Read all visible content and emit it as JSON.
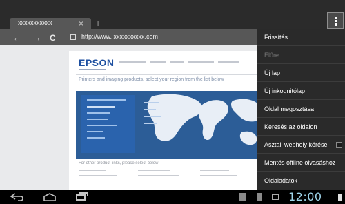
{
  "browser": {
    "tab": {
      "title": "xxxxxxxxxxx",
      "close_glyph": "×",
      "new_tab_glyph": "+"
    },
    "toolbar": {
      "back_glyph": "←",
      "forward_glyph": "→",
      "reload_glyph": "C",
      "url": "http://www. xxxxxxxxxx.com"
    },
    "menu_button_icon": "vertical-ellipsis-icon"
  },
  "webpage": {
    "logo": "EPSON",
    "headline": "Printers and imaging products, select your region from the list below",
    "footer_text": "For other product links, please select below"
  },
  "menu": {
    "items": [
      {
        "label": "Frissítés",
        "enabled": true
      },
      {
        "label": "Előre",
        "enabled": false
      },
      {
        "label": "Új lap",
        "enabled": true
      },
      {
        "label": "Új inkognitólap",
        "enabled": true
      },
      {
        "label": "Oldal megosztása",
        "enabled": true
      },
      {
        "label": "Keresés az oldalon",
        "enabled": true
      },
      {
        "label": "Asztali webhely kérése",
        "enabled": true,
        "checkbox": false
      },
      {
        "label": "Mentés offline olvasáshoz",
        "enabled": true
      },
      {
        "label": "Oldaladatok",
        "enabled": true
      }
    ]
  },
  "system_bar": {
    "time": "12:00",
    "icons": [
      "back-icon",
      "home-icon",
      "recent-apps-icon",
      "notification-icon",
      "wifi-icon",
      "battery-icon"
    ]
  },
  "colors": {
    "tabbar": "#2b2b2b",
    "toolbar": "#575757",
    "menu_bg": "#2a2a2a",
    "clock": "#9fd5ea",
    "hero_blue": "#2c5d97"
  }
}
